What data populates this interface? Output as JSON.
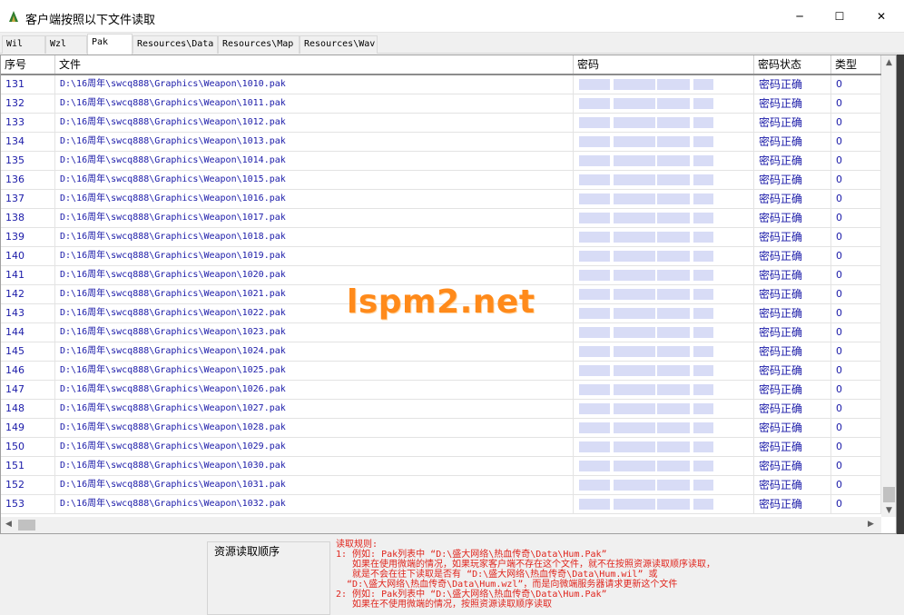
{
  "window": {
    "title": "客户端按照以下文件读取",
    "minimize": "─",
    "maximize": "☐",
    "close": "✕"
  },
  "tabs": [
    {
      "label": "Wil"
    },
    {
      "label": "Wzl"
    },
    {
      "label": "Pak"
    },
    {
      "label": "Resources\\Data"
    },
    {
      "label": "Resources\\Map"
    },
    {
      "label": "Resources\\Wav"
    }
  ],
  "active_tab": "Pak",
  "table": {
    "columns": [
      "序号",
      "文件",
      "密码",
      "密码状态",
      "类型"
    ],
    "rows": [
      {
        "no": "131",
        "path": "D:\\16周年\\swcq888\\Graphics\\Weapon\\1010.pak",
        "status": "密码正确",
        "type": "0"
      },
      {
        "no": "132",
        "path": "D:\\16周年\\swcq888\\Graphics\\Weapon\\1011.pak",
        "status": "密码正确",
        "type": "0"
      },
      {
        "no": "133",
        "path": "D:\\16周年\\swcq888\\Graphics\\Weapon\\1012.pak",
        "status": "密码正确",
        "type": "0"
      },
      {
        "no": "134",
        "path": "D:\\16周年\\swcq888\\Graphics\\Weapon\\1013.pak",
        "status": "密码正确",
        "type": "0"
      },
      {
        "no": "135",
        "path": "D:\\16周年\\swcq888\\Graphics\\Weapon\\1014.pak",
        "status": "密码正确",
        "type": "0"
      },
      {
        "no": "136",
        "path": "D:\\16周年\\swcq888\\Graphics\\Weapon\\1015.pak",
        "status": "密码正确",
        "type": "0"
      },
      {
        "no": "137",
        "path": "D:\\16周年\\swcq888\\Graphics\\Weapon\\1016.pak",
        "status": "密码正确",
        "type": "0"
      },
      {
        "no": "138",
        "path": "D:\\16周年\\swcq888\\Graphics\\Weapon\\1017.pak",
        "status": "密码正确",
        "type": "0"
      },
      {
        "no": "139",
        "path": "D:\\16周年\\swcq888\\Graphics\\Weapon\\1018.pak",
        "status": "密码正确",
        "type": "0"
      },
      {
        "no": "140",
        "path": "D:\\16周年\\swcq888\\Graphics\\Weapon\\1019.pak",
        "status": "密码正确",
        "type": "0"
      },
      {
        "no": "141",
        "path": "D:\\16周年\\swcq888\\Graphics\\Weapon\\1020.pak",
        "status": "密码正确",
        "type": "0"
      },
      {
        "no": "142",
        "path": "D:\\16周年\\swcq888\\Graphics\\Weapon\\1021.pak",
        "status": "密码正确",
        "type": "0"
      },
      {
        "no": "143",
        "path": "D:\\16周年\\swcq888\\Graphics\\Weapon\\1022.pak",
        "status": "密码正确",
        "type": "0"
      },
      {
        "no": "144",
        "path": "D:\\16周年\\swcq888\\Graphics\\Weapon\\1023.pak",
        "status": "密码正确",
        "type": "0"
      },
      {
        "no": "145",
        "path": "D:\\16周年\\swcq888\\Graphics\\Weapon\\1024.pak",
        "status": "密码正确",
        "type": "0"
      },
      {
        "no": "146",
        "path": "D:\\16周年\\swcq888\\Graphics\\Weapon\\1025.pak",
        "status": "密码正确",
        "type": "0"
      },
      {
        "no": "147",
        "path": "D:\\16周年\\swcq888\\Graphics\\Weapon\\1026.pak",
        "status": "密码正确",
        "type": "0"
      },
      {
        "no": "148",
        "path": "D:\\16周年\\swcq888\\Graphics\\Weapon\\1027.pak",
        "status": "密码正确",
        "type": "0"
      },
      {
        "no": "149",
        "path": "D:\\16周年\\swcq888\\Graphics\\Weapon\\1028.pak",
        "status": "密码正确",
        "type": "0"
      },
      {
        "no": "150",
        "path": "D:\\16周年\\swcq888\\Graphics\\Weapon\\1029.pak",
        "status": "密码正确",
        "type": "0"
      },
      {
        "no": "151",
        "path": "D:\\16周年\\swcq888\\Graphics\\Weapon\\1030.pak",
        "status": "密码正确",
        "type": "0"
      },
      {
        "no": "152",
        "path": "D:\\16周年\\swcq888\\Graphics\\Weapon\\1031.pak",
        "status": "密码正确",
        "type": "0"
      },
      {
        "no": "153",
        "path": "D:\\16周年\\swcq888\\Graphics\\Weapon\\1032.pak",
        "status": "密码正确",
        "type": "0"
      }
    ]
  },
  "watermark": "lspm2.net",
  "bottom": {
    "order_label": "资源读取顺序",
    "rules": [
      "读取规则:",
      "1: 例如: Pak列表中 “D:\\盛大网络\\热血传奇\\Data\\Hum.Pak”",
      "   如果在使用微端的情况，如果玩家客户端不存在这个文件，就不在按照资源读取顺序读取，",
      "   就是不会在往下读取是否有 “D:\\盛大网络\\热血传奇\\Data\\Hum.wil” 或",
      "  “D:\\盛大网络\\热血传奇\\Data\\Hum.wzl”，而是向微端服务器请求更新这个文件",
      "2: 例如: Pak列表中 “D:\\盛大网络\\热血传奇\\Data\\Hum.Pak”",
      "   如果在不使用微端的情况，按照资源读取顺序读取"
    ]
  },
  "colors": {
    "text_blue": "#1a1aa8",
    "rules_red": "#e0241c",
    "watermark_orange": "#ff8a1a",
    "password_blur": "#d8dcf6"
  }
}
